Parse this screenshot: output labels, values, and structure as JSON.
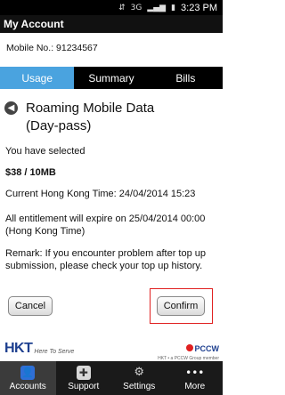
{
  "status_bar": {
    "time": "3:23 PM",
    "icons": [
      "usb-icon",
      "sim-icon",
      "signal-3g-icon",
      "signal-bars-icon",
      "battery-icon"
    ]
  },
  "app": {
    "title": "My Account",
    "mobile_no_label": "Mobile No.: 91234567"
  },
  "tabs": [
    {
      "label": "Usage",
      "active": true
    },
    {
      "label": "Summary",
      "active": false
    },
    {
      "label": "Bills",
      "active": false
    }
  ],
  "page": {
    "title_line1": "Roaming Mobile Data",
    "title_line2": "(Day-pass)"
  },
  "content": {
    "selected_label": "You have selected",
    "price": "$38 / 10MB",
    "current_time": "Current Hong Kong Time: 24/04/2014 15:23",
    "expiry_line1": "All entitlement will expire on 25/04/2014 00:00",
    "expiry_line2": "(Hong Kong Time)",
    "remark_line1": "Remark: If you encounter problem after top up",
    "remark_line2": "submission, please check your top up history."
  },
  "buttons": {
    "cancel": "Cancel",
    "confirm": "Confirm"
  },
  "brand": {
    "hkt": "HKT",
    "tagline": "Here To Serve",
    "pccw": "PCCW",
    "pccw_sub": "HKT • a PCCW Group member"
  },
  "bottom_nav": [
    {
      "label": "Accounts",
      "icon": "accounts-icon",
      "active": true
    },
    {
      "label": "Support",
      "icon": "support-icon",
      "active": false
    },
    {
      "label": "Settings",
      "icon": "settings-icon",
      "active": false
    },
    {
      "label": "More",
      "icon": "more-icon",
      "active": false
    }
  ],
  "colors": {
    "active_tab": "#4aa3df",
    "highlight_border": "#e02020",
    "brand_blue": "#1d3f8f"
  }
}
